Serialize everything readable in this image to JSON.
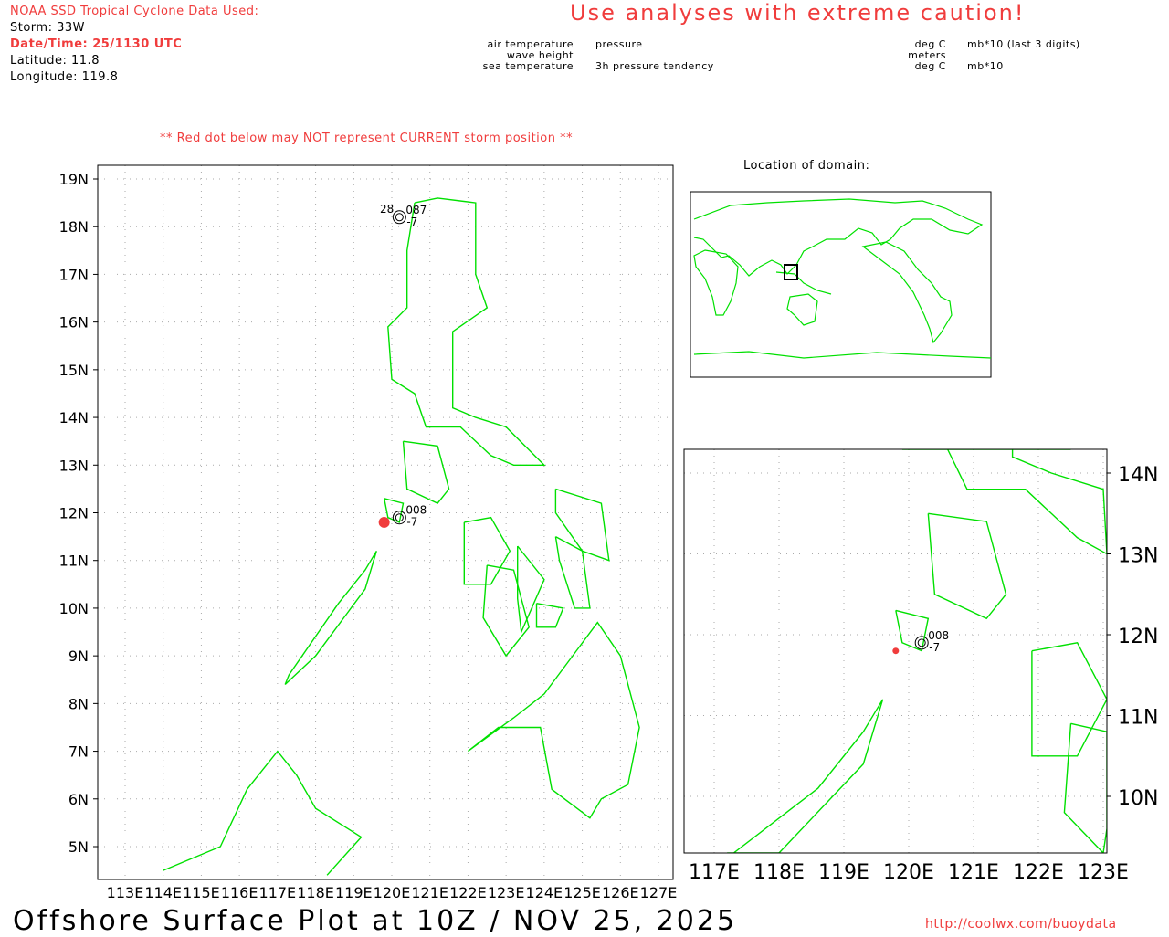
{
  "header": {
    "source": "NOAA SSD Tropical Cyclone Data Used:",
    "storm": "Storm: 33W",
    "datetime": "Date/Time: 25/1130 UTC",
    "latitude": "Latitude: 11.8",
    "longitude": "Longitude: 119.8",
    "caution": "Use analyses with extreme caution!"
  },
  "legend": {
    "air_temperature": "air temperature",
    "wave_height": "wave height",
    "sea_temperature": "sea temperature",
    "pressure": "pressure",
    "tendency": "3h pressure tendency",
    "unit_air": "deg C",
    "unit_wave": "meters",
    "unit_sea": "deg C",
    "unit_pressure": "mb*10 (last 3 digits)",
    "unit_tendency": "mb*10"
  },
  "warning": "** Red dot below may NOT represent CURRENT storm position **",
  "domain_title": "Location of domain:",
  "footer": {
    "title": "Offshore Surface Plot at 10Z / NOV 25, 2025",
    "url": "http://coolwx.com/buoydata"
  },
  "main_map": {
    "lat_ticks": [
      "19N",
      "18N",
      "17N",
      "16N",
      "15N",
      "14N",
      "13N",
      "12N",
      "11N",
      "10N",
      "9N",
      "8N",
      "7N",
      "6N",
      "5N"
    ],
    "lon_ticks": [
      "113E",
      "114E",
      "115E",
      "116E",
      "117E",
      "118E",
      "119E",
      "120E",
      "121E",
      "122E",
      "123E",
      "124E",
      "125E",
      "126E",
      "127E"
    ]
  },
  "inset_map": {
    "lat_ticks": [
      "14N",
      "13N",
      "12N",
      "11N",
      "10N"
    ],
    "lon_ticks": [
      "117E",
      "118E",
      "119E",
      "120E",
      "121E",
      "122E",
      "123E"
    ]
  },
  "storm_position": {
    "lat": 11.8,
    "lon": 119.8
  },
  "stations": [
    {
      "lat": 18.2,
      "lon": 120.2,
      "air": "28",
      "pressure": "087",
      "tendency": "-7"
    },
    {
      "lat": 11.9,
      "lon": 120.2,
      "air": "",
      "pressure": "008",
      "tendency": "-7"
    }
  ],
  "colors": {
    "coast": "#00e000",
    "storm": "#f03c3c",
    "text_red": "#f03c3c"
  }
}
